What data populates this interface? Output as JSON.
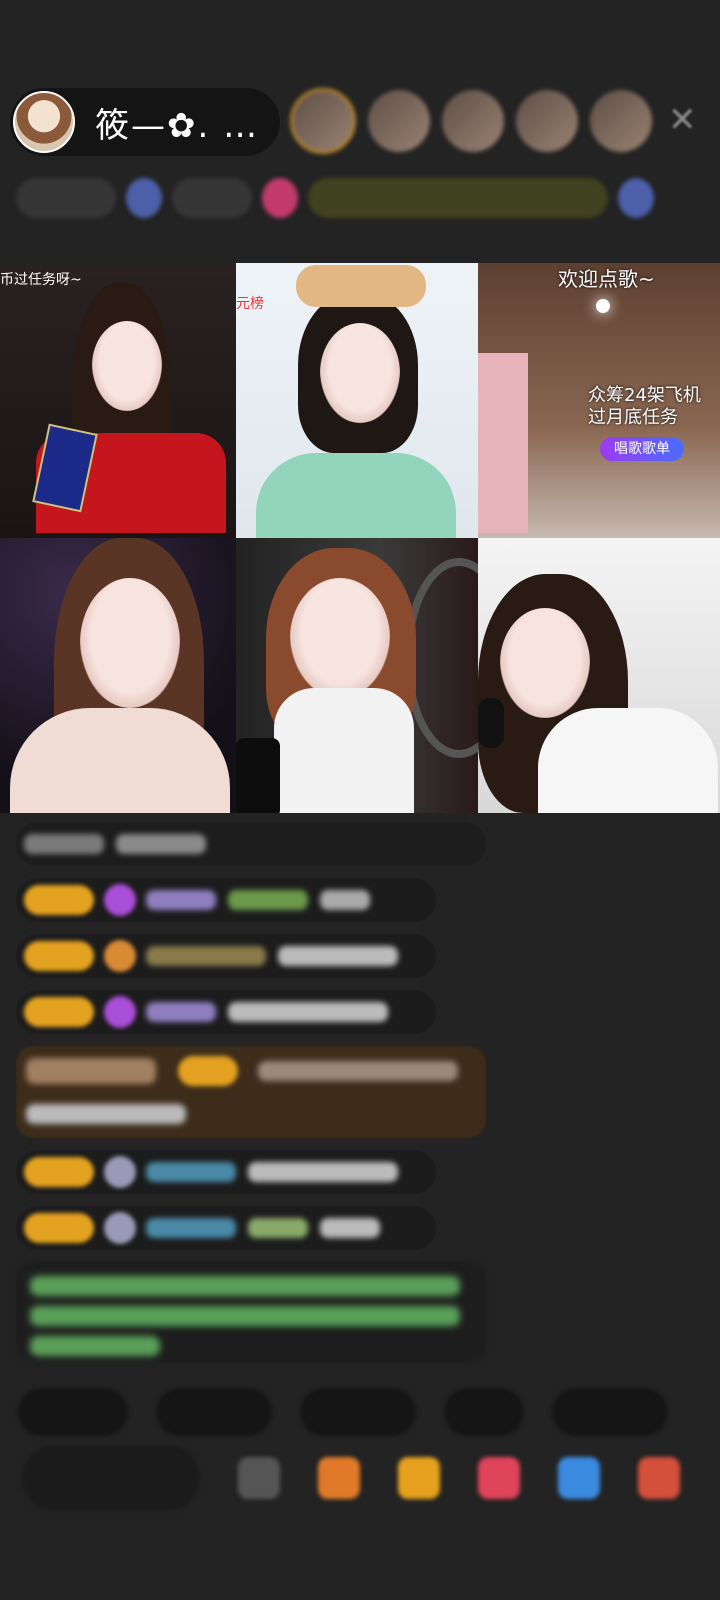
{
  "host": {
    "name": "筱—✿. …"
  },
  "header": {
    "close_glyph": "✕"
  },
  "tiles": {
    "t1_text": "币过任务呀~",
    "t2_text": "元榜",
    "t3_welcome": "欢迎点歌~",
    "t3_line1": "众筹24架飞机",
    "t3_line2": "过月底任务",
    "t3_button": "唱歌歌单"
  },
  "colors": {
    "background": "#232323",
    "badge_gold": "#e3a220",
    "gem_purple": "#a94ed8"
  }
}
